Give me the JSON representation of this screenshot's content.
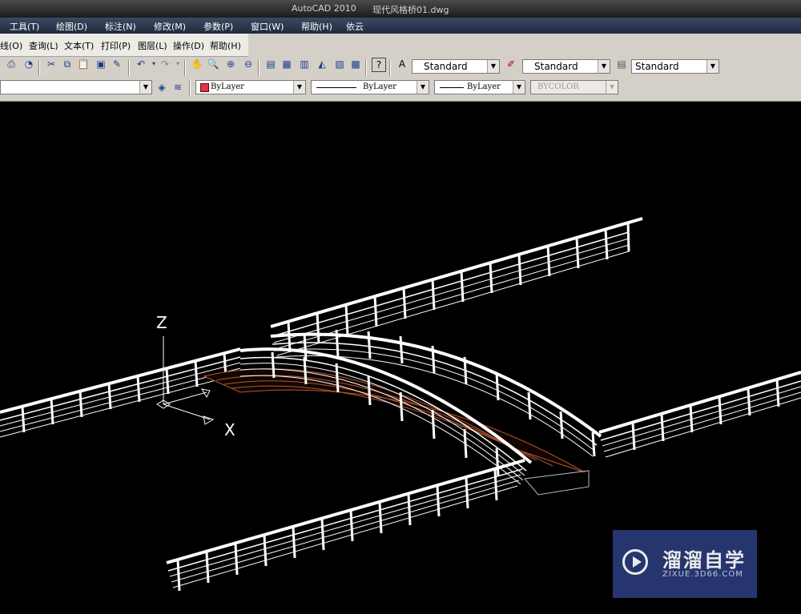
{
  "titlebar": {
    "app": "AutoCAD 2010",
    "file": "现代风格桥01.dwg"
  },
  "menubar": [
    "工具(T)",
    "绘图(D)",
    "标注(N)",
    "修改(M)",
    "参数(P)",
    "窗口(W)",
    "帮助(H)",
    "依云"
  ],
  "submenu": [
    "线(O)",
    "查询(L)",
    "文本(T)",
    "打印(P)",
    "图层(L)",
    "操作(D)",
    "帮助(H)"
  ],
  "styles": {
    "text_style": "Standard",
    "dim_style": "Standard",
    "table_style": "Standard"
  },
  "properties": {
    "color": "ByLayer",
    "linetype": "ByLayer",
    "lineweight": "ByLayer",
    "plotstyle": "BYCOLOR"
  },
  "ucs": {
    "z_label": "Z",
    "x_label": "X"
  },
  "watermark": {
    "title": "溜溜自学",
    "url": "ZIXUE.3D66.COM"
  },
  "colors": {
    "rail": "#ffffff",
    "deck_accent": "#b5562e",
    "background": "#000000"
  }
}
